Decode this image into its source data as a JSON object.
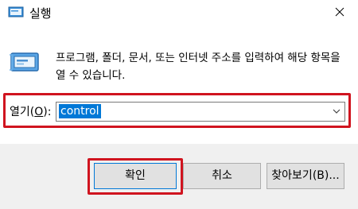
{
  "window": {
    "title": "실행",
    "close_icon": "close-icon",
    "app_icon": "run-dialog-icon"
  },
  "body": {
    "description": "프로그램, 폴더, 문서, 또는 인터넷 주소를 입력하여 해당 항목을 열 수 있습니다."
  },
  "open": {
    "label_prefix": "열기(",
    "label_accel": "O",
    "label_suffix": "):",
    "value": "control"
  },
  "buttons": {
    "ok": "확인",
    "cancel": "취소",
    "browse": "찾아보기(B)..."
  },
  "colors": {
    "highlight": "#d0141f",
    "selection": "#0078d7",
    "footer_bg": "#f0f0f0"
  }
}
